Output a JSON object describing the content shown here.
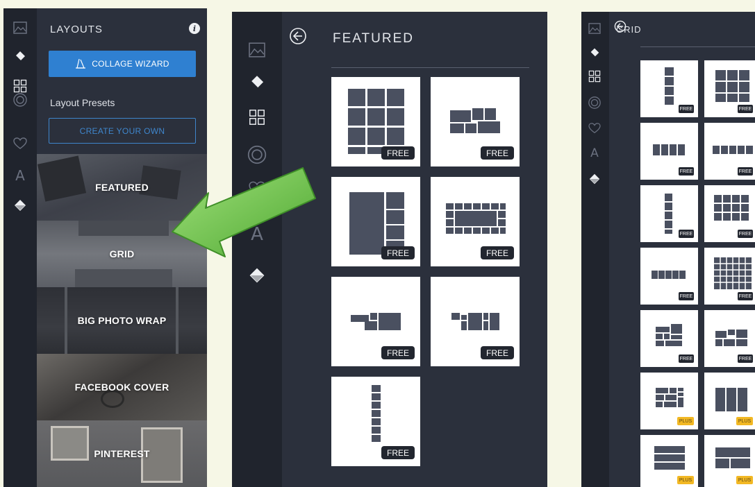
{
  "layouts_panel": {
    "title": "LAYOUTS",
    "info_icon": "i",
    "wizard_label": "COLLAGE WIZARD",
    "presets_label": "Layout Presets",
    "create_label": "CREATE YOUR OWN",
    "categories": [
      "FEATURED",
      "GRID",
      "BIG PHOTO WRAP",
      "FACEBOOK COVER",
      "PINTEREST"
    ]
  },
  "featured_panel": {
    "title": "FEATURED",
    "badge": "FREE",
    "layouts": [
      {
        "name": "3x4 grid",
        "badge": "FREE"
      },
      {
        "name": "two row mosaic",
        "badge": "FREE"
      },
      {
        "name": "big left with stack",
        "badge": "FREE"
      },
      {
        "name": "frame border",
        "badge": "FREE"
      },
      {
        "name": "offset blocks",
        "badge": "FREE"
      },
      {
        "name": "center blocks",
        "badge": "FREE"
      },
      {
        "name": "vertical strip",
        "badge": "FREE"
      }
    ]
  },
  "grid_panel": {
    "title": "GRID",
    "badges": [
      "FREE",
      "FREE",
      "FREE",
      "FREE",
      "FREE",
      "FREE",
      "FREE",
      "FREE",
      "FREE",
      "FREE",
      "PLUS",
      "PLUS",
      "PLUS",
      "PLUS"
    ]
  },
  "rail_icons": [
    "image-icon",
    "paint-brush-icon",
    "layouts-grid-icon",
    "circle-target-icon",
    "heart-icon",
    "text-icon",
    "paint-bucket-icon"
  ],
  "colors": {
    "panel_bg": "#2b303c",
    "rail_bg": "#20242d",
    "accent_blue": "#2f80d1",
    "plus_badge": "#f2b824",
    "arrow_green": "#6cc84a"
  }
}
